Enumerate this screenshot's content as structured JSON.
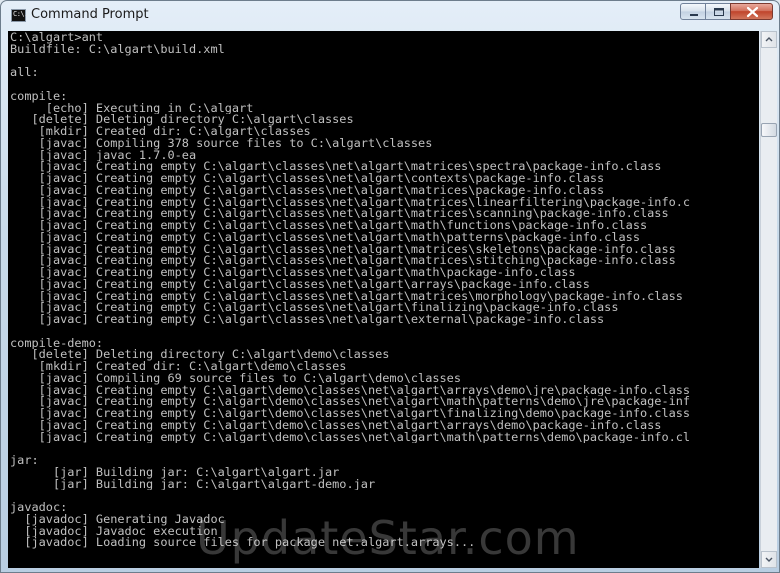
{
  "window": {
    "title": "Command Prompt",
    "icon_text": "C:\\."
  },
  "controls": {
    "minimize": "minimize-icon",
    "maximize": "maximize-icon",
    "close": "close-icon"
  },
  "console": {
    "lines": [
      "C:\\algart>ant",
      "Buildfile: C:\\algart\\build.xml",
      "",
      "all:",
      "",
      "compile:",
      "     [echo] Executing in C:\\algart",
      "   [delete] Deleting directory C:\\algart\\classes",
      "    [mkdir] Created dir: C:\\algart\\classes",
      "    [javac] Compiling 378 source files to C:\\algart\\classes",
      "    [javac] javac 1.7.0-ea",
      "    [javac] Creating empty C:\\algart\\classes\\net\\algart\\matrices\\spectra\\package-info.class",
      "    [javac] Creating empty C:\\algart\\classes\\net\\algart\\contexts\\package-info.class",
      "    [javac] Creating empty C:\\algart\\classes\\net\\algart\\matrices\\package-info.class",
      "    [javac] Creating empty C:\\algart\\classes\\net\\algart\\matrices\\linearfiltering\\package-info.c",
      "    [javac] Creating empty C:\\algart\\classes\\net\\algart\\matrices\\scanning\\package-info.class",
      "    [javac] Creating empty C:\\algart\\classes\\net\\algart\\math\\functions\\package-info.class",
      "    [javac] Creating empty C:\\algart\\classes\\net\\algart\\math\\patterns\\package-info.class",
      "    [javac] Creating empty C:\\algart\\classes\\net\\algart\\matrices\\skeletons\\package-info.class",
      "    [javac] Creating empty C:\\algart\\classes\\net\\algart\\matrices\\stitching\\package-info.class",
      "    [javac] Creating empty C:\\algart\\classes\\net\\algart\\math\\package-info.class",
      "    [javac] Creating empty C:\\algart\\classes\\net\\algart\\arrays\\package-info.class",
      "    [javac] Creating empty C:\\algart\\classes\\net\\algart\\matrices\\morphology\\package-info.class",
      "    [javac] Creating empty C:\\algart\\classes\\net\\algart\\finalizing\\package-info.class",
      "    [javac] Creating empty C:\\algart\\classes\\net\\algart\\external\\package-info.class",
      "",
      "compile-demo:",
      "   [delete] Deleting directory C:\\algart\\demo\\classes",
      "    [mkdir] Created dir: C:\\algart\\demo\\classes",
      "    [javac] Compiling 69 source files to C:\\algart\\demo\\classes",
      "    [javac] Creating empty C:\\algart\\demo\\classes\\net\\algart\\arrays\\demo\\jre\\package-info.class",
      "    [javac] Creating empty C:\\algart\\demo\\classes\\net\\algart\\math\\patterns\\demo\\jre\\package-inf",
      "    [javac] Creating empty C:\\algart\\demo\\classes\\net\\algart\\finalizing\\demo\\package-info.class",
      "    [javac] Creating empty C:\\algart\\demo\\classes\\net\\algart\\arrays\\demo\\package-info.class",
      "    [javac] Creating empty C:\\algart\\demo\\classes\\net\\algart\\math\\patterns\\demo\\package-info.cl",
      "",
      "jar:",
      "      [jar] Building jar: C:\\algart\\algart.jar",
      "      [jar] Building jar: C:\\algart\\algart-demo.jar",
      "",
      "javadoc:",
      "  [javadoc] Generating Javadoc",
      "  [javadoc] Javadoc execution",
      "  [javadoc] Loading source files for package net.algart.arrays..."
    ]
  },
  "watermark": "UpdateStar.com"
}
